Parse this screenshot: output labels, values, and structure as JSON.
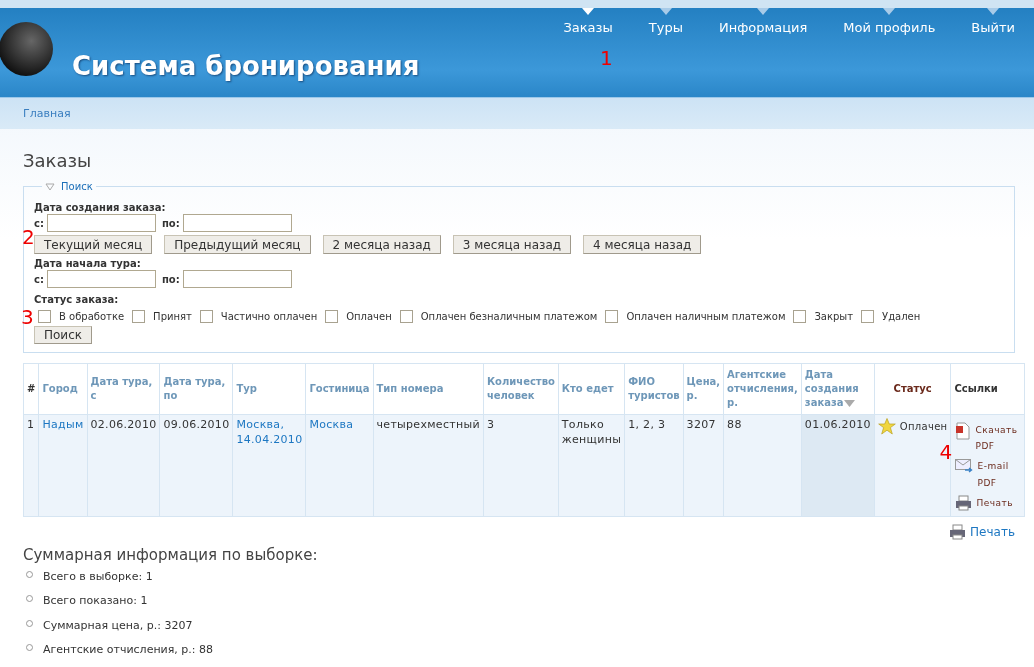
{
  "header": {
    "title": "Система бронирования",
    "nav": [
      {
        "label": "Заказы",
        "selected": true
      },
      {
        "label": "Туры",
        "selected": false
      },
      {
        "label": "Информация",
        "selected": false
      },
      {
        "label": "Мой профиль",
        "selected": false
      },
      {
        "label": "Выйти",
        "selected": false
      }
    ]
  },
  "breadcrumb": "Главная",
  "page_title": "Заказы",
  "search": {
    "legend": "Поиск",
    "expanded": true,
    "created_label": "Дата создания заказа:",
    "from_label": "с:",
    "to_label": "по:",
    "quick_buttons": [
      "Текущий месяц",
      "Предыдущий месяц",
      "2 месяца назад",
      "3 месяца назад",
      "4 месяца назад"
    ],
    "tour_label": "Дата начала тура:",
    "tour_from_label": "с:",
    "tour_to_label": "по:",
    "status_label": "Статус заказа:",
    "statuses": [
      {
        "label": "В обработке",
        "checked": false
      },
      {
        "label": "Принят",
        "checked": false
      },
      {
        "label": "Частично оплачен",
        "checked": false
      },
      {
        "label": "Оплачен",
        "checked": false
      },
      {
        "label": "Оплачен безналичным платежом",
        "checked": false
      },
      {
        "label": "Оплачен наличным платежом",
        "checked": false
      },
      {
        "label": "Закрыт",
        "checked": false
      },
      {
        "label": "Удален",
        "checked": false
      }
    ],
    "submit": "Поиск"
  },
  "table": {
    "columns": [
      {
        "label": "#",
        "kind": "plain",
        "sorted": false
      },
      {
        "label": "Город",
        "kind": "sortable",
        "sorted": false
      },
      {
        "label": "Дата тура, с",
        "kind": "sortable",
        "sorted": false
      },
      {
        "label": "Дата тура, по",
        "kind": "sortable",
        "sorted": false
      },
      {
        "label": "Тур",
        "kind": "sortable",
        "sorted": false
      },
      {
        "label": "Гостиница",
        "kind": "sortable",
        "sorted": false
      },
      {
        "label": "Тип номера",
        "kind": "sortable",
        "sorted": false
      },
      {
        "label": "Количество человек",
        "kind": "sortable",
        "sorted": false
      },
      {
        "label": "Кто едет",
        "kind": "sortable",
        "sorted": false
      },
      {
        "label": "ФИО туристов",
        "kind": "sortable",
        "sorted": false
      },
      {
        "label": "Цена, р.",
        "kind": "sortable",
        "sorted": false
      },
      {
        "label": "Агентские отчисления, р.",
        "kind": "sortable",
        "sorted": false
      },
      {
        "label": "Дата создания заказа",
        "kind": "sortable",
        "sorted": true
      },
      {
        "label": "Статус",
        "kind": "status",
        "sorted": false
      },
      {
        "label": "Ссылки",
        "kind": "plain",
        "sorted": false
      }
    ],
    "rows": [
      {
        "cells": [
          {
            "text": "1",
            "link": false
          },
          {
            "text": "Надым",
            "link": true
          },
          {
            "text": "02.06.2010",
            "link": false
          },
          {
            "text": "09.06.2010",
            "link": false
          },
          {
            "text": "Москва, 14.04.2010",
            "link": true
          },
          {
            "text": "Москва",
            "link": true
          },
          {
            "text": "четырехместный",
            "link": false
          },
          {
            "text": "3",
            "link": false
          },
          {
            "text": "Только женщины",
            "link": false
          },
          {
            "text": "1, 2, 3",
            "link": false
          },
          {
            "text": "3207",
            "link": false
          },
          {
            "text": "88",
            "link": false
          },
          {
            "text": "01.06.2010",
            "link": false
          }
        ],
        "status": "Оплачен",
        "links": [
          {
            "kind": "pdf",
            "label": "Скачать PDF"
          },
          {
            "kind": "email",
            "label": "E-mail PDF"
          },
          {
            "kind": "print",
            "label": "Печать"
          }
        ]
      }
    ]
  },
  "print_link": "Печать",
  "summary": {
    "title": "Суммарная информация по выборке:",
    "items": [
      "Всего в выборке: 1",
      "Всего показано: 1",
      "Суммарная цена, р.: 3207",
      "Агентские отчисления, р.: 88"
    ]
  },
  "annotations": [
    "1",
    "2",
    "3",
    "4"
  ]
}
